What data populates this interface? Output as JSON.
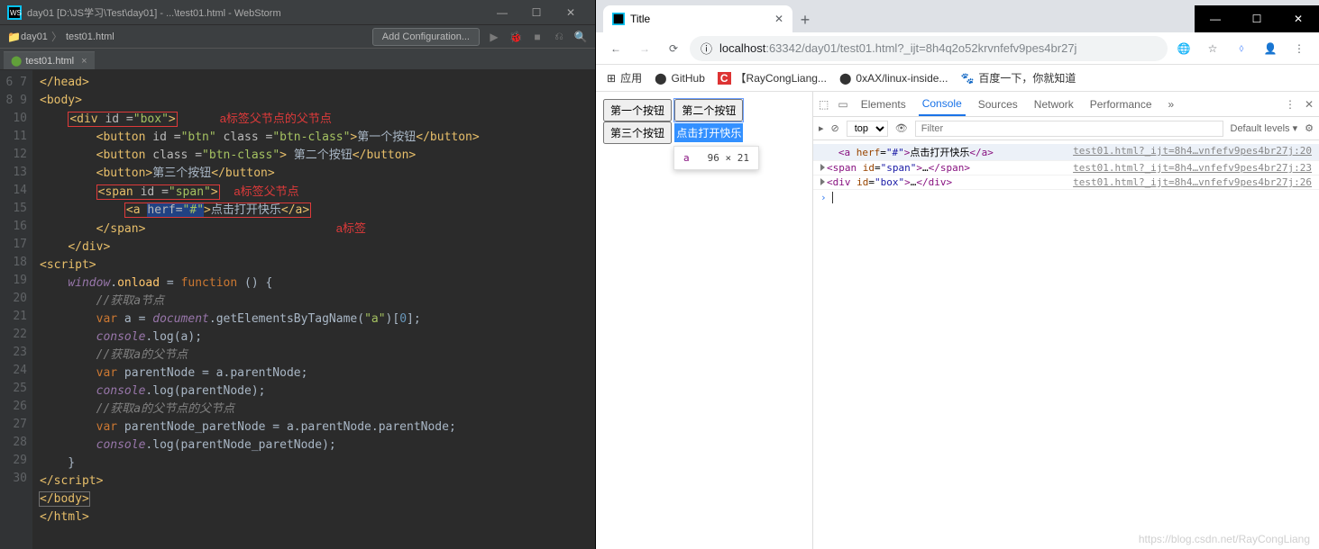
{
  "webstorm": {
    "title": "day01 [D:\\JS学习\\Test\\day01] - ...\\test01.html - WebStorm",
    "breadcrumb": {
      "folder": "day01",
      "file": "test01.html"
    },
    "add_config": "Add Configuration...",
    "tab": "test01.html",
    "annotations": {
      "parent_of_parent": "a标签父节点的父节点",
      "parent": "a标签父节点",
      "a_tag": "a标签"
    },
    "gutter": [
      "6",
      "7",
      "8",
      "9",
      "10",
      "11",
      "12",
      "13",
      "14",
      "15",
      "16",
      "17",
      "18",
      "19",
      "20",
      "21",
      "22",
      "23",
      "24",
      "25",
      "26",
      "27",
      "28",
      "29",
      "30"
    ]
  },
  "chrome": {
    "tab_title": "Title",
    "win": {
      "min": "—",
      "max": "☐",
      "close": "✕"
    },
    "url_host": "localhost",
    "url_port": ":63342",
    "url_path": "/day01/test01.html?_ijt=8h4q2o52krvnfefv9pes4br27j",
    "bookmarks": {
      "apps": "应用",
      "github": "GitHub",
      "ray": "【RayCongLiang...",
      "linux": "0xAX/linux-inside...",
      "baidu": "百度一下，你就知道"
    },
    "page": {
      "btn1": "第一个按钮",
      "btn2": "第二个按钮",
      "btn3": "第三个按钮",
      "link": "点击打开快乐",
      "tooltip_el": "a",
      "tooltip_size": "96 × 21"
    },
    "devtools": {
      "tabs": {
        "elements": "Elements",
        "console": "Console",
        "sources": "Sources",
        "network": "Network",
        "performance": "Performance"
      },
      "ctx": "top",
      "filter_ph": "Filter",
      "levels": "Default levels ▾",
      "rows": [
        {
          "html": "<a herf=\"#\">点击打开快乐</a>",
          "src": "test01.html?_ijt=8h4…vnfefv9pes4br27j:20"
        },
        {
          "html": "<span id=\"span\">…</span>",
          "src": "test01.html?_ijt=8h4…vnfefv9pes4br27j:23"
        },
        {
          "html": "<div id=\"box\">…</div>",
          "src": "test01.html?_ijt=8h4…vnfefv9pes4br27j:26"
        }
      ]
    },
    "watermark": "https://blog.csdn.net/RayCongLiang"
  }
}
